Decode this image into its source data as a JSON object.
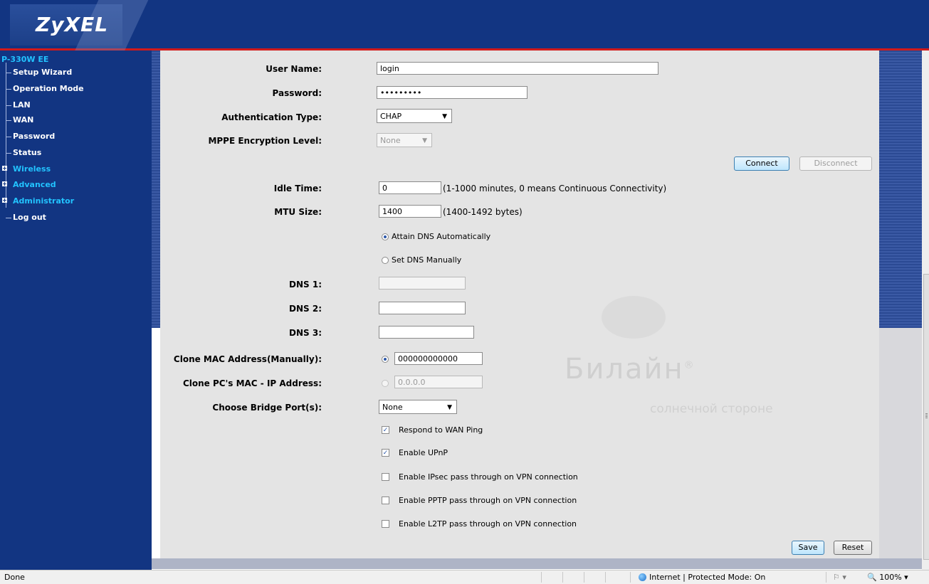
{
  "brand": {
    "logo_text": "ZyXEL"
  },
  "sidebar": {
    "device": "P-330W EE",
    "items": [
      {
        "label": "Setup Wizard"
      },
      {
        "label": "Operation Mode"
      },
      {
        "label": "LAN"
      },
      {
        "label": "WAN"
      },
      {
        "label": "Password"
      },
      {
        "label": "Status"
      },
      {
        "label": "Wireless"
      },
      {
        "label": "Advanced"
      },
      {
        "label": "Administrator"
      },
      {
        "label": "Log out"
      }
    ]
  },
  "form": {
    "user_name": {
      "label": "User Name:",
      "value": "login"
    },
    "password": {
      "label": "Password:",
      "value": "•••••••••"
    },
    "auth_type": {
      "label": "Authentication Type:",
      "value": "CHAP"
    },
    "mppe": {
      "label": "MPPE Encryption Level:",
      "value": "None"
    },
    "connect_label": "Connect",
    "disconnect_label": "Disconnect",
    "idle_time": {
      "label": "Idle Time:",
      "value": "0",
      "hint": "(1-1000 minutes, 0 means Continuous Connectivity)"
    },
    "mtu": {
      "label": "MTU Size:",
      "value": "1400",
      "hint": "(1400-1492 bytes)"
    },
    "dns_auto": "Attain DNS Automatically",
    "dns_manual": "Set DNS Manually",
    "dns1": {
      "label": "DNS 1:",
      "value": ""
    },
    "dns2": {
      "label": "DNS 2:",
      "value": ""
    },
    "dns3": {
      "label": "DNS 3:",
      "value": ""
    },
    "clone_mac": {
      "label": "Clone MAC Address(Manually):",
      "value": "000000000000"
    },
    "clone_pc": {
      "label": "Clone PC's MAC - IP Address:",
      "value": "0.0.0.0"
    },
    "bridge_port": {
      "label": "Choose Bridge Port(s):",
      "value": "None"
    },
    "checkboxes": [
      {
        "label": "Respond to WAN Ping",
        "checked": true
      },
      {
        "label": "Enable UPnP",
        "checked": true
      },
      {
        "label": "Enable IPsec pass through on VPN connection",
        "checked": false
      },
      {
        "label": "Enable PPTP pass through on VPN connection",
        "checked": false
      },
      {
        "label": "Enable L2TP pass through on VPN connection",
        "checked": false
      }
    ],
    "save_label": "Save",
    "reset_label": "Reset"
  },
  "watermark": {
    "brand": "Билайн",
    "mark": "®",
    "tagline": "солнечной стороне"
  },
  "statusbar": {
    "left": "Done",
    "zone": "Internet | Protected Mode: On",
    "zoom": "100%"
  },
  "colors": {
    "header": "#123582",
    "accent_line": "#d11a1a",
    "menu_highlight": "#22c3ff",
    "content_bg": "#e4e4e4"
  }
}
